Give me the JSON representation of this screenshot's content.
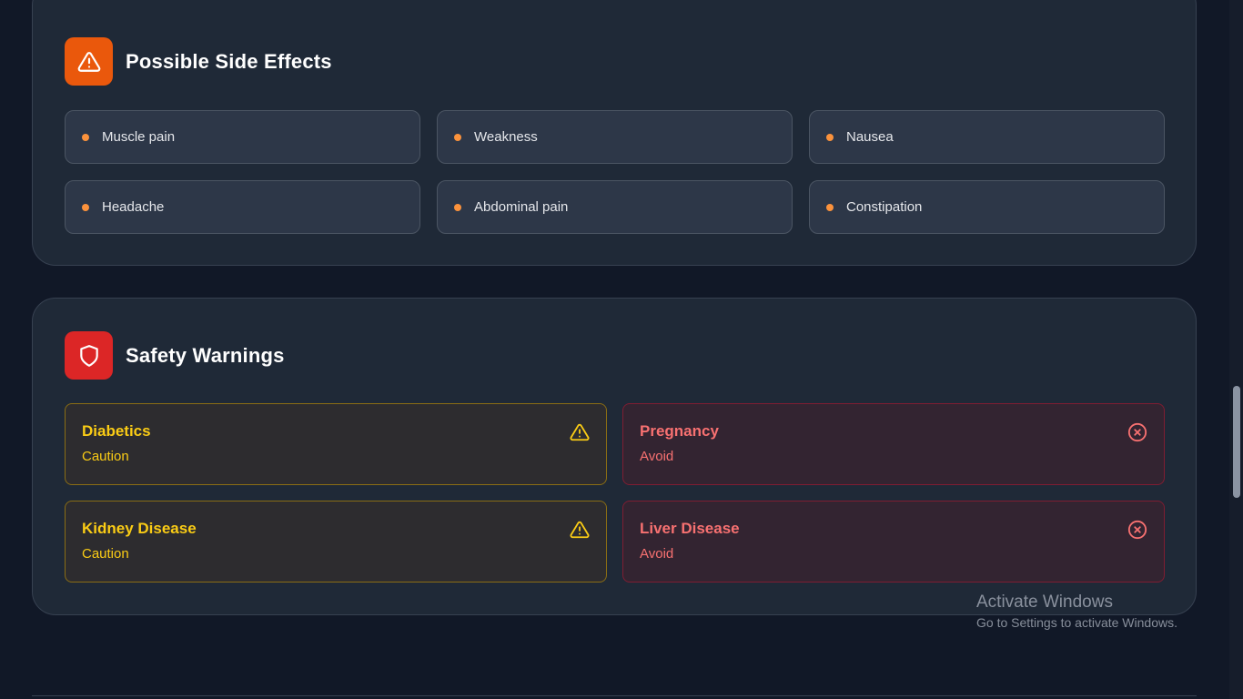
{
  "side_effects": {
    "title": "Possible Side Effects",
    "icon": "warning-triangle-icon",
    "accent": "#ea580c",
    "dot_color": "#fb923c",
    "items": [
      {
        "label": "Muscle pain"
      },
      {
        "label": "Weakness"
      },
      {
        "label": "Nausea"
      },
      {
        "label": "Headache"
      },
      {
        "label": "Abdominal pain"
      },
      {
        "label": "Constipation"
      }
    ]
  },
  "safety": {
    "title": "Safety Warnings",
    "icon": "shield-icon",
    "accent": "#dc2626",
    "warnings": [
      {
        "title": "Diabetics",
        "level": "Caution",
        "icon": "warning-triangle-icon",
        "color": "#facc15"
      },
      {
        "title": "Pregnancy",
        "level": "Avoid",
        "icon": "x-circle-icon",
        "color": "#f87171"
      },
      {
        "title": "Kidney Disease",
        "level": "Caution",
        "icon": "warning-triangle-icon",
        "color": "#facc15"
      },
      {
        "title": "Liver Disease",
        "level": "Avoid",
        "icon": "x-circle-icon",
        "color": "#f87171"
      }
    ]
  },
  "watermark": {
    "title": "Activate Windows",
    "subtitle": "Go to Settings to activate Windows."
  }
}
